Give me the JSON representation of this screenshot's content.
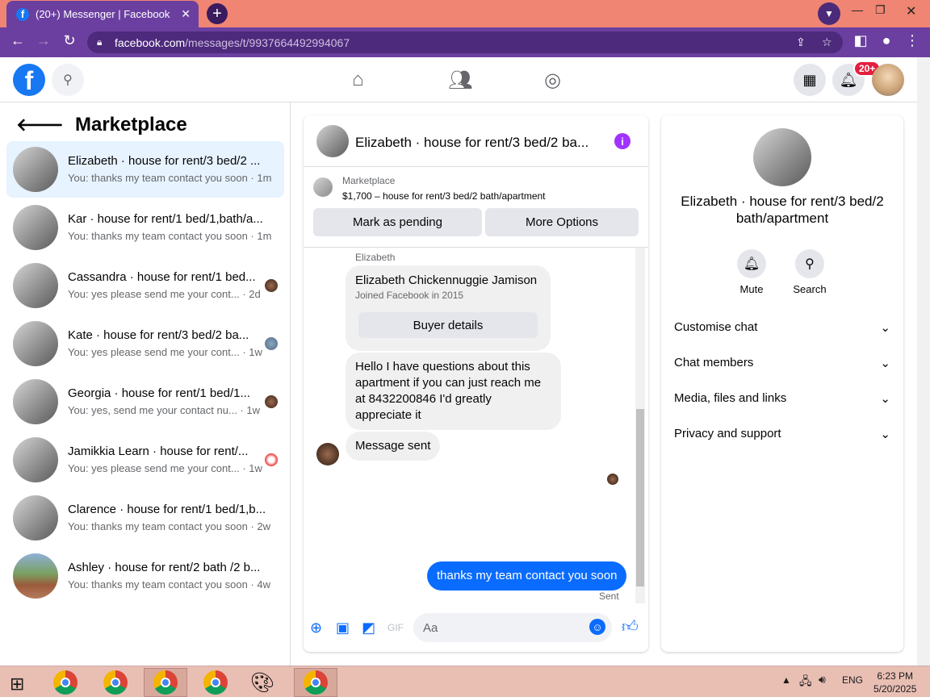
{
  "browser": {
    "tab_title": "(20+) Messenger | Facebook",
    "url_host": "facebook.com",
    "url_path": "/messages/t/9937664492994067"
  },
  "header": {
    "notification_badge": "20+"
  },
  "sidebar": {
    "title": "Marketplace",
    "conversations": [
      {
        "title": "Elizabeth · house for rent/3 bed/2 ...",
        "preview": "You: thanks my team contact you soon · 1m"
      },
      {
        "title": "Kar · house for rent/1 bed/1,bath/a...",
        "preview": "You: thanks my team contact you soon · 1m"
      },
      {
        "title": "Cassandra · house for rent/1 bed...",
        "preview": "You: yes please send me your cont... · 2d"
      },
      {
        "title": "Kate · house for rent/3 bed/2 ba...",
        "preview": "You: yes please send me your cont... · 1w"
      },
      {
        "title": "Georgia · house for rent/1 bed/1...",
        "preview": "You: yes, send me your contact nu... · 1w"
      },
      {
        "title": "Jamikkia Learn · house for rent/...",
        "preview": "You: yes please send me your cont... · 1w"
      },
      {
        "title": "Clarence · house for rent/1 bed/1,b...",
        "preview": "You: thanks my team contact you soon · 2w"
      },
      {
        "title": "Ashley · house for rent/2 bath /2 b...",
        "preview": "You: thanks my team contact you soon · 4w"
      }
    ]
  },
  "chat": {
    "title": "Elizabeth · house for rent/3 bed/2 ba...",
    "marketplace_label": "Marketplace",
    "listing": "$1,700 – house for rent/3 bed/2 bath/apartment",
    "mark_pending": "Mark as pending",
    "more_options": "More Options",
    "sender_name": "Elizabeth",
    "card_name": "Elizabeth Chickennuggie Jamison",
    "card_joined": "Joined Facebook in 2015",
    "buyer_details": "Buyer details",
    "msg1": "Hello I have questions about this apartment if you can just reach me at 8432200846 I'd greatly appreciate it",
    "msg2": "Message sent",
    "my_msg": "thanks my team contact you soon",
    "sent_status": "Sent",
    "input_placeholder": "Aa"
  },
  "details": {
    "name": "Elizabeth · house for rent/3 bed/2 bath/apartment",
    "mute": "Mute",
    "search": "Search",
    "sections": [
      "Customise chat",
      "Chat members",
      "Media, files and links",
      "Privacy and support"
    ]
  },
  "taskbar": {
    "lang": "ENG",
    "time": "6:23 PM",
    "date": "5/20/2025"
  },
  "colors": {
    "accent": "#0a6cff",
    "browser": "#6b3fa0",
    "titlebar": "#ef8572"
  }
}
